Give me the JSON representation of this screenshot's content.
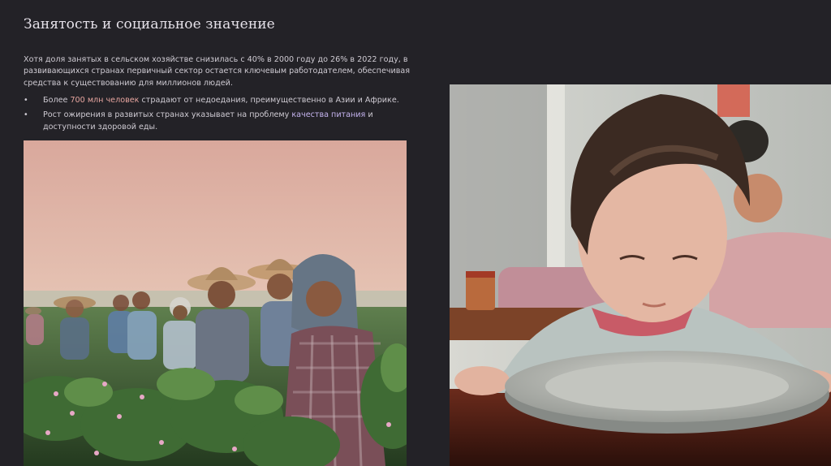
{
  "slide": {
    "title": "Занятость и социальное значение",
    "intro": "Хотя доля занятых в сельском хозяйстве снизилась с 40% в 2000 году до 26% в 2022 году, в развивающихся странах первичный сектор остается ключевым работодателем, обеспечивая средства к существованию для миллионов людей.",
    "bullets": [
      {
        "marker": "•",
        "before": "Более ",
        "highlight": "700 млн человек",
        "after": " страдают от недоедания, преимущественно в Азии и Африке."
      },
      {
        "marker": "•",
        "before": "Рост ожирения в развитых странах указывает на проблему ",
        "highlight": "качества питания",
        "after": " и доступности здоровой еды."
      }
    ]
  },
  "images": {
    "left": {
      "subject": "farm-workers-photo"
    },
    "right": {
      "subject": "child-empty-plate-photo"
    }
  },
  "colors": {
    "background": "#232227",
    "title": "#e6e2ea",
    "body_text": "#cfcbd3",
    "highlight_orange": "#e8a6a0",
    "highlight_violet": "#c5b4ef"
  }
}
